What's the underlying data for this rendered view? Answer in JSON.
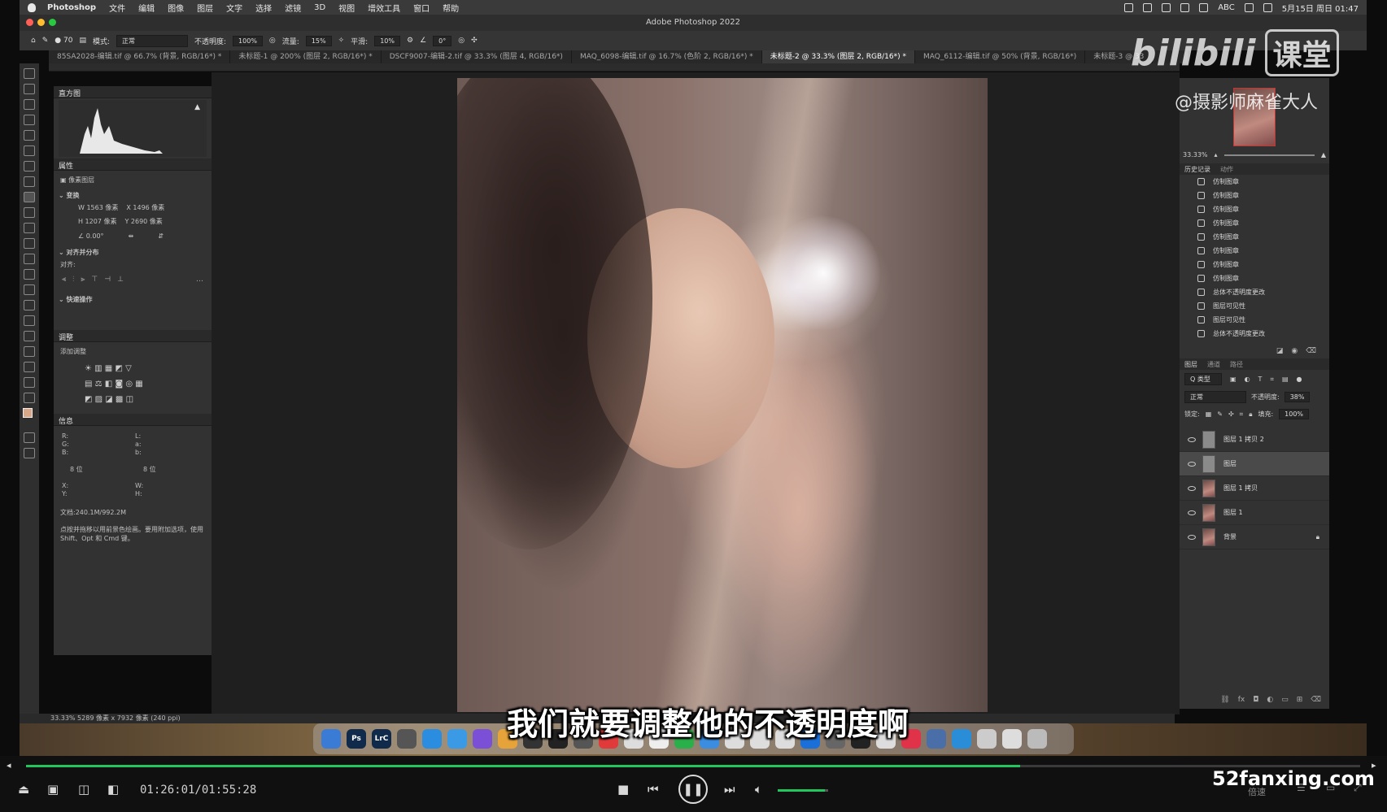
{
  "menubar": {
    "app_name": "Photoshop",
    "items": [
      "文件",
      "编辑",
      "图像",
      "图层",
      "文字",
      "选择",
      "滤镜",
      "3D",
      "视图",
      "增效工具",
      "窗口",
      "帮助"
    ],
    "input_method": "ABC",
    "datetime": "5月15日 周日 01:47"
  },
  "window": {
    "title": "Adobe Photoshop 2022"
  },
  "options_bar": {
    "brush_size": "70",
    "mode_label": "模式:",
    "mode_value": "正常",
    "opacity_label": "不透明度:",
    "opacity_value": "100%",
    "flow_label": "流量:",
    "flow_value": "15%",
    "smooth_label": "平滑:",
    "smooth_value": "10%",
    "angle_value": "0°"
  },
  "tabs": [
    "85SA2028-编辑.tif @ 66.7% (背景, RGB/16*) *",
    "未标题-1 @ 200% (图层 2, RGB/16*) *",
    "DSCF9007-编辑-2.tif @ 33.3% (图层 4, RGB/16*)",
    "MAQ_6098-编辑.tif @ 16.7% (色阶 2, RGB/16*) *",
    "未标题-2 @ 33.3% (图层 2, RGB/16*) *",
    "MAQ_6112-编辑.tif @ 50% (背景, RGB/16*)",
    "未标题-3 @ 33"
  ],
  "active_tab_index": 4,
  "left_panels": {
    "histogram_title": "直方图",
    "properties_title": "属性",
    "pixel_layer": "像素图层",
    "transform_title": "变换",
    "w": "W  1563 像素",
    "x": "X  1496 像素",
    "h": "H  1207 像素",
    "y": "Y  2690 像素",
    "angle": "0.00°",
    "align_title": "对齐并分布",
    "align_label": "对齐:",
    "quick_actions": "快速操作",
    "adjustments_title": "调整",
    "add_adjustment": "添加调整",
    "info_title": "信息",
    "info_rgb": "R:\nG:\nB:",
    "info_lab": "L:\na:\nb:",
    "bits_left": "8 位",
    "bits_right": "8 位",
    "xy": "X:\nY:",
    "wh": "W:\nH:",
    "doc_size": "文档:240.1M/992.2M",
    "hint": "点按并拖移以用前景色绘画。要用附加选项，使用 Shift、Opt 和 Cmd 键。"
  },
  "navigator": {
    "zoom": "33.33%"
  },
  "history": {
    "tabs": [
      "历史记录",
      "动作"
    ],
    "items": [
      "仿制图章",
      "仿制图章",
      "仿制图章",
      "仿制图章",
      "仿制图章",
      "仿制图章",
      "仿制图章",
      "仿制图章",
      "总体不透明度更改",
      "图层可见性",
      "图层可见性",
      "总体不透明度更改"
    ]
  },
  "layers_panel": {
    "tabs": [
      "图层",
      "通道",
      "路径"
    ],
    "filter_label": "Q 类型",
    "blend_mode": "正常",
    "opacity_label": "不透明度:",
    "opacity_value": "38%",
    "lock_label": "锁定:",
    "fill_label": "填充:",
    "fill_value": "100%",
    "layers": [
      {
        "name": "图层 1 拷贝 2",
        "selected": false,
        "locked": false
      },
      {
        "name": "图层",
        "selected": true,
        "locked": false
      },
      {
        "name": "图层 1 拷贝",
        "selected": false,
        "locked": false
      },
      {
        "name": "图层 1",
        "selected": false,
        "locked": false
      },
      {
        "name": "背景",
        "selected": false,
        "locked": true
      }
    ]
  },
  "status": {
    "text": "33.33%   5289 像素 x 7932 像素 (240 ppi)"
  },
  "dock": {
    "apps": [
      {
        "name": "Finder",
        "label": "",
        "color": "#3a7bd5"
      },
      {
        "name": "Photoshop",
        "label": "Ps",
        "color": "#0f2a4a"
      },
      {
        "name": "Lightroom Classic",
        "label": "LrC",
        "color": "#0f2a4a"
      },
      {
        "name": "Screenshot",
        "label": "",
        "color": "#555"
      },
      {
        "name": "Safari",
        "label": "",
        "color": "#2a8de0"
      },
      {
        "name": "Mail",
        "label": "",
        "color": "#3a9ae6"
      },
      {
        "name": "App",
        "label": "",
        "color": "#7b4fd6"
      },
      {
        "name": "Photos",
        "label": "",
        "color": "#e6a33a"
      },
      {
        "name": "App",
        "label": "",
        "color": "#333"
      },
      {
        "name": "App",
        "label": "",
        "color": "#222"
      },
      {
        "name": "App",
        "label": "",
        "color": "#555"
      },
      {
        "name": "App",
        "label": "",
        "color": "#e03a3a"
      },
      {
        "name": "App",
        "label": "",
        "color": "#ddd"
      },
      {
        "name": "App",
        "label": "",
        "color": "#eee"
      },
      {
        "name": "App",
        "label": "",
        "color": "#2ab04a"
      },
      {
        "name": "App",
        "label": "",
        "color": "#3a8de0"
      },
      {
        "name": "App",
        "label": "",
        "color": "#ddd"
      },
      {
        "name": "App",
        "label": "",
        "color": "#ddd"
      },
      {
        "name": "App",
        "label": "",
        "color": "#ddd"
      },
      {
        "name": "App",
        "label": "",
        "color": "#1a6fd8"
      },
      {
        "name": "App",
        "label": "",
        "color": "#666"
      },
      {
        "name": "App",
        "label": "",
        "color": "#222"
      },
      {
        "name": "App",
        "label": "",
        "color": "#ddd"
      },
      {
        "name": "App",
        "label": "",
        "color": "#e0334a"
      },
      {
        "name": "App",
        "label": "",
        "color": "#4a6fa8"
      },
      {
        "name": "App",
        "label": "",
        "color": "#2a8dd8"
      },
      {
        "name": "App",
        "label": "",
        "color": "#ccc"
      },
      {
        "name": "App",
        "label": "",
        "color": "#ddd"
      },
      {
        "name": "Trash",
        "label": "",
        "color": "#bbb"
      }
    ]
  },
  "subtitle": "我们就要调整他的不透明度啊",
  "watermark": {
    "logo": "bilibili",
    "ke": "课堂",
    "author": "@摄影师麻雀大人"
  },
  "player": {
    "time": "01:26:01/01:55:28",
    "progress": 0.745,
    "volume": 0.94,
    "site": "52fanxing.com",
    "speed": "倍速"
  },
  "colors": {
    "accent_green": "#22c55e"
  }
}
